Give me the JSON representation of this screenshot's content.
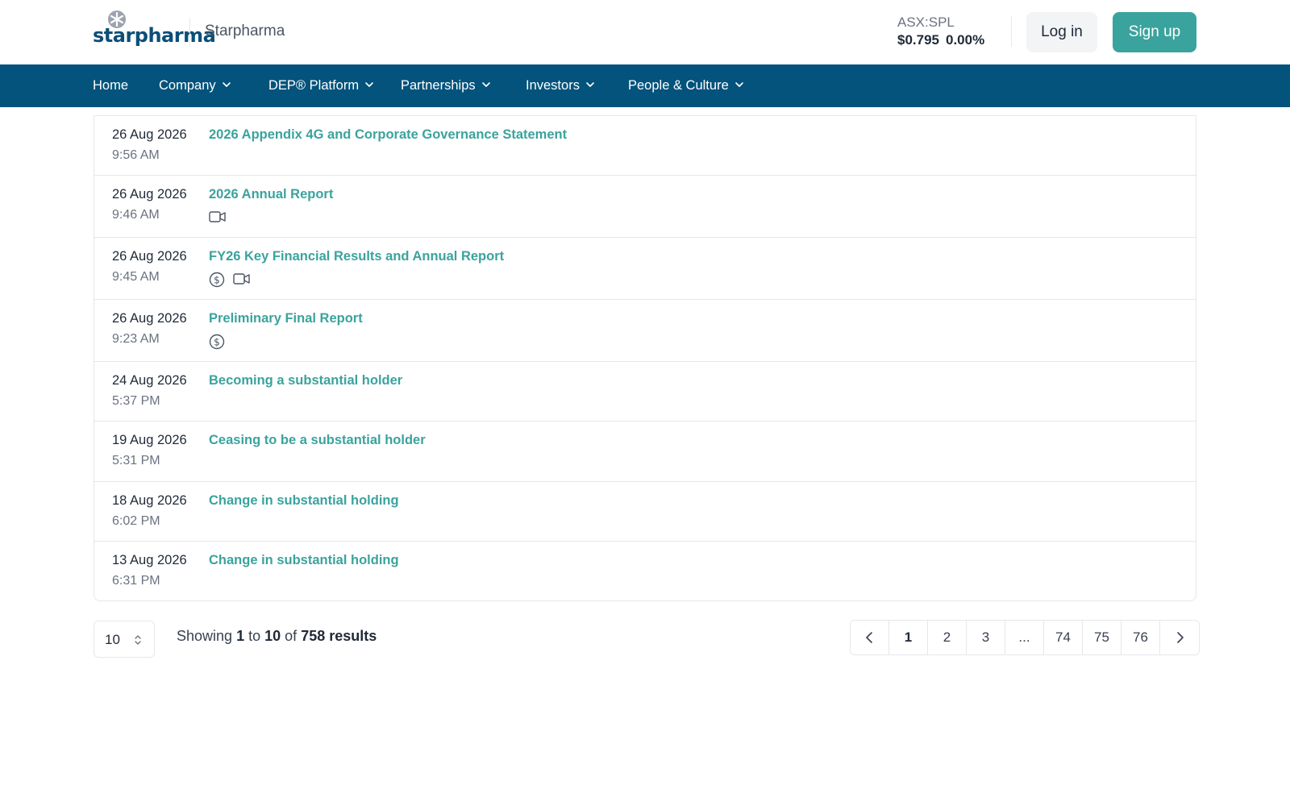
{
  "header": {
    "logo_text": "starpharma",
    "company_name": "Starpharma",
    "ticker_symbol": "ASX:SPL",
    "ticker_price": "$0.795",
    "ticker_change": "0.00%",
    "login_label": "Log in",
    "signup_label": "Sign up"
  },
  "nav": {
    "items": [
      {
        "label": "Home",
        "has_dropdown": false
      },
      {
        "label": "Company",
        "has_dropdown": true
      },
      {
        "label": "DEP® Platform",
        "has_dropdown": true
      },
      {
        "label": "Partnerships",
        "has_dropdown": true
      },
      {
        "label": "Investors",
        "has_dropdown": true
      },
      {
        "label": "People & Culture",
        "has_dropdown": true
      }
    ]
  },
  "announcements": [
    {
      "date": "26 Aug 2026",
      "time": "9:56 AM",
      "title": "2026 Appendix 4G and Corporate Governance Statement",
      "icons": []
    },
    {
      "date": "26 Aug 2026",
      "time": "9:46 AM",
      "title": "2026 Annual Report",
      "icons": [
        "video-icon"
      ]
    },
    {
      "date": "26 Aug 2026",
      "time": "9:45 AM",
      "title": "FY26 Key Financial Results and Annual Report",
      "icons": [
        "dollar-icon",
        "video-icon"
      ]
    },
    {
      "date": "26 Aug 2026",
      "time": "9:23 AM",
      "title": "Preliminary Final Report",
      "icons": [
        "dollar-icon"
      ]
    },
    {
      "date": "24 Aug 2026",
      "time": "5:37 PM",
      "title": "Becoming a substantial holder",
      "icons": []
    },
    {
      "date": "19 Aug 2026",
      "time": "5:31 PM",
      "title": "Ceasing to be a substantial holder",
      "icons": []
    },
    {
      "date": "18 Aug 2026",
      "time": "6:02 PM",
      "title": "Change in substantial holding",
      "icons": []
    },
    {
      "date": "13 Aug 2026",
      "time": "6:31 PM",
      "title": "Change in substantial holding",
      "icons": []
    }
  ],
  "pagination": {
    "per_page": "10",
    "showing_prefix": "Showing",
    "from": "1",
    "to_word": "to",
    "to": "10",
    "of_word": "of",
    "total": "758 results",
    "pages": [
      "1",
      "2",
      "3",
      "...",
      "74",
      "75",
      "76"
    ],
    "current_page": "1"
  },
  "colors": {
    "nav_bg": "#03537c",
    "accent": "#3aa39d",
    "brand": "#0b4f78"
  }
}
